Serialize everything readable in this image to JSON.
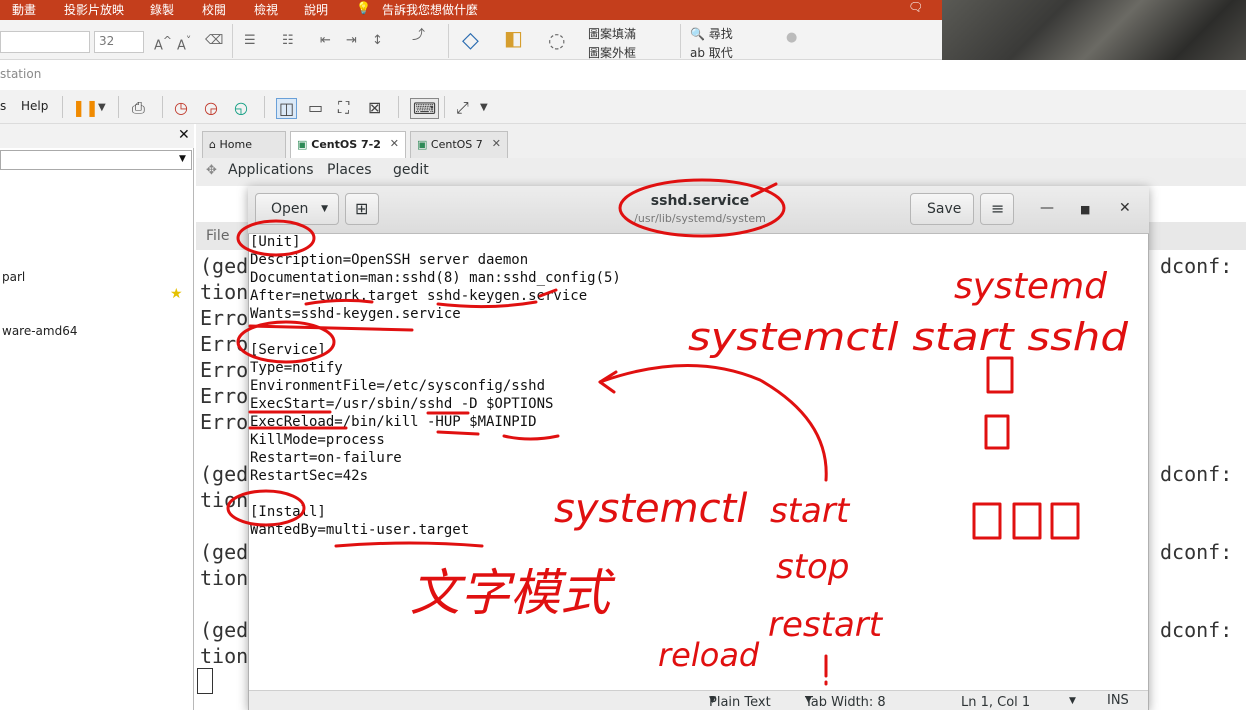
{
  "ppt": {
    "menu": [
      "動畫",
      "投影片放映",
      "錄製",
      "校閱",
      "檢視",
      "說明",
      "告訴我您想做什麼"
    ],
    "font_size": "32",
    "paragraph": [
      "圖案填滿",
      "圖案外框"
    ],
    "editing": [
      "尋找",
      "取代"
    ]
  },
  "vmware": {
    "window_title_fragment": "station",
    "menu_fragment": "s",
    "menu_help": "Help",
    "tabs": [
      {
        "label": "Home",
        "icon": "home-icon"
      },
      {
        "label": "CentOS 7-2",
        "icon": "vm-icon",
        "active": true
      },
      {
        "label": "CentOS 7",
        "icon": "vm-icon"
      }
    ],
    "sidebar_items": [
      "parl",
      "ware-amd64"
    ]
  },
  "guest": {
    "topbar": {
      "applications": "Applications",
      "places": "Places",
      "app": "gedit"
    },
    "terminal_menu": "File",
    "terminal_left": [
      "(ged",
      "tion",
      "Erro",
      "Erro",
      "Erro",
      "Erro",
      "Erro",
      "(ged",
      "tion",
      "(ged",
      "tion",
      "(ged",
      "tion"
    ],
    "terminal_right": [
      "dconf:",
      "dconf:",
      "dconf:",
      "dconf:"
    ]
  },
  "gedit": {
    "open_label": "Open",
    "save_label": "Save",
    "title": "sshd.service",
    "path": "/usr/lib/systemd/system",
    "content": "[Unit]\nDescription=OpenSSH server daemon\nDocumentation=man:sshd(8) man:sshd_config(5)\nAfter=network.target sshd-keygen.service\nWants=sshd-keygen.service\n\n[Service]\nType=notify\nEnvironmentFile=/etc/sysconfig/sshd\nExecStart=/usr/sbin/sshd -D $OPTIONS\nExecReload=/bin/kill -HUP $MAINPID\nKillMode=process\nRestart=on-failure\nRestartSec=42s\n\n[Install]\nWantedBy=multi-user.target",
    "status": {
      "syntax": "Plain Text",
      "tab_width": "Tab Width: 8",
      "position": "Ln 1, Col 1",
      "mode": "INS"
    }
  },
  "annotations": {
    "color": "#e01010",
    "notes": [
      "systemd",
      "systemctl start sshd",
      "systemctl",
      "start",
      "stop",
      "restart",
      "reload",
      "文字模式"
    ]
  }
}
